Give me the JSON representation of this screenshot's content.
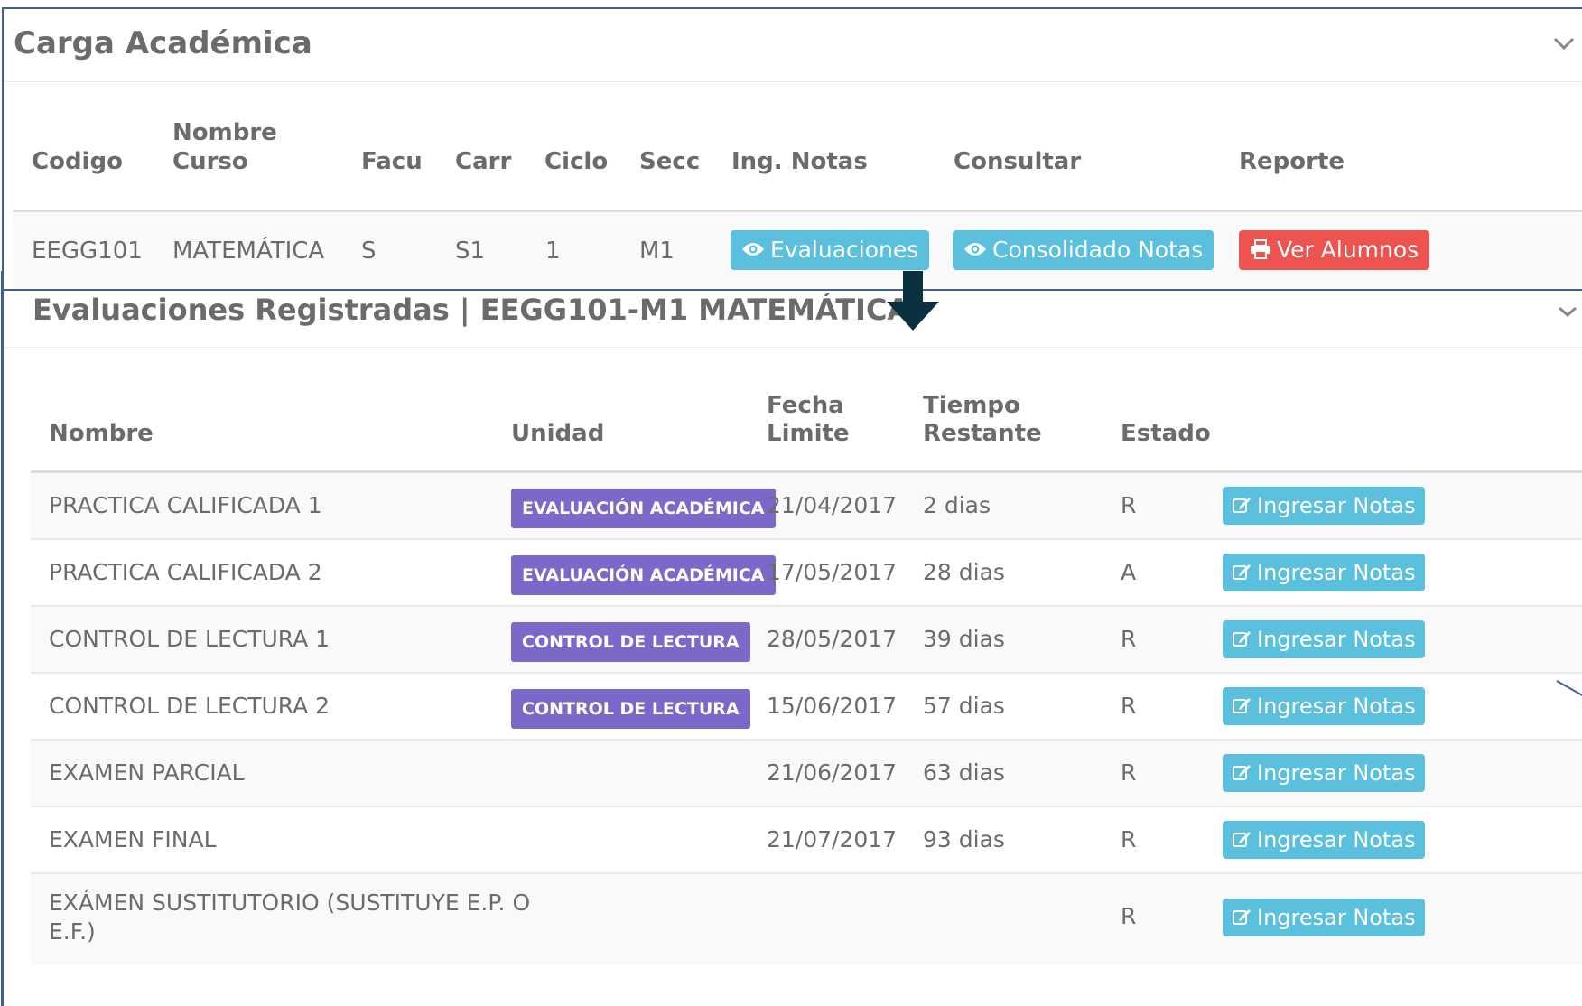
{
  "carga": {
    "title": "Carga Académica",
    "headers": {
      "codigo": "Codigo",
      "nombre_l1": "Nombre",
      "nombre_l2": "Curso",
      "facu": "Facu",
      "carr": "Carr",
      "ciclo": "Ciclo",
      "secc": "Secc",
      "ing_notas": "Ing. Notas",
      "consultar": "Consultar",
      "reporte": "Reporte"
    },
    "row": {
      "codigo": "EEGG101",
      "curso": "MATEMÁTICA",
      "facu": "S",
      "carr": "S1",
      "ciclo": "1",
      "secc": "M1",
      "btn_evaluaciones": "Evaluaciones",
      "btn_consolidado": "Consolidado Notas",
      "btn_ver_alumnos": "Ver Alumnos"
    }
  },
  "evaluaciones": {
    "title": "Evaluaciones Registradas | EEGG101-M1 MATEMÁTICA",
    "headers": {
      "nombre": "Nombre",
      "unidad": "Unidad",
      "fecha_l1": "Fecha",
      "fecha_l2": "Limite",
      "tiempo_l1": "Tiempo",
      "tiempo_l2": "Restante",
      "estado": "Estado"
    },
    "rows": [
      {
        "nombre": "PRACTICA CALIFICADA 1",
        "unidad": "EVALUACIÓN ACADÉMICA",
        "fecha": "21/04/2017",
        "tiempo": "2 dias",
        "estado": "R",
        "accion": "Ingresar Notas"
      },
      {
        "nombre": "PRACTICA CALIFICADA 2",
        "unidad": "EVALUACIÓN ACADÉMICA",
        "fecha": "17/05/2017",
        "tiempo": "28 dias",
        "estado": "A",
        "accion": "Ingresar Notas"
      },
      {
        "nombre": "CONTROL DE LECTURA 1",
        "unidad": "CONTROL DE LECTURA",
        "fecha": "28/05/2017",
        "tiempo": "39 dias",
        "estado": "R",
        "accion": "Ingresar Notas"
      },
      {
        "nombre": "CONTROL DE LECTURA 2",
        "unidad": "CONTROL DE LECTURA",
        "fecha": "15/06/2017",
        "tiempo": "57 dias",
        "estado": "R",
        "accion": "Ingresar Notas"
      },
      {
        "nombre": "EXAMEN PARCIAL",
        "unidad": "",
        "fecha": "21/06/2017",
        "tiempo": "63 dias",
        "estado": "R",
        "accion": "Ingresar Notas"
      },
      {
        "nombre": "EXAMEN FINAL",
        "unidad": "",
        "fecha": "21/07/2017",
        "tiempo": "93 dias",
        "estado": "R",
        "accion": "Ingresar Notas"
      },
      {
        "nombre_l1": "EXÁMEN SUSTITUTORIO (SUSTITUYE E.P. O",
        "nombre_l2": "E.F.)",
        "unidad": "",
        "fecha": "",
        "tiempo": "",
        "estado": "R",
        "accion": "Ingresar Notas"
      }
    ]
  },
  "colors": {
    "panel_border": "#3f5f9a",
    "btn_info": "#5bc0de",
    "btn_danger": "#ef5350",
    "badge": "#7b68c8",
    "arrow": "#0b3140"
  },
  "icons": {
    "chevron": "chevron-down-icon",
    "eye": "eye-icon",
    "print": "print-icon",
    "edit": "edit-icon",
    "arrow": "arrow-down-icon"
  }
}
